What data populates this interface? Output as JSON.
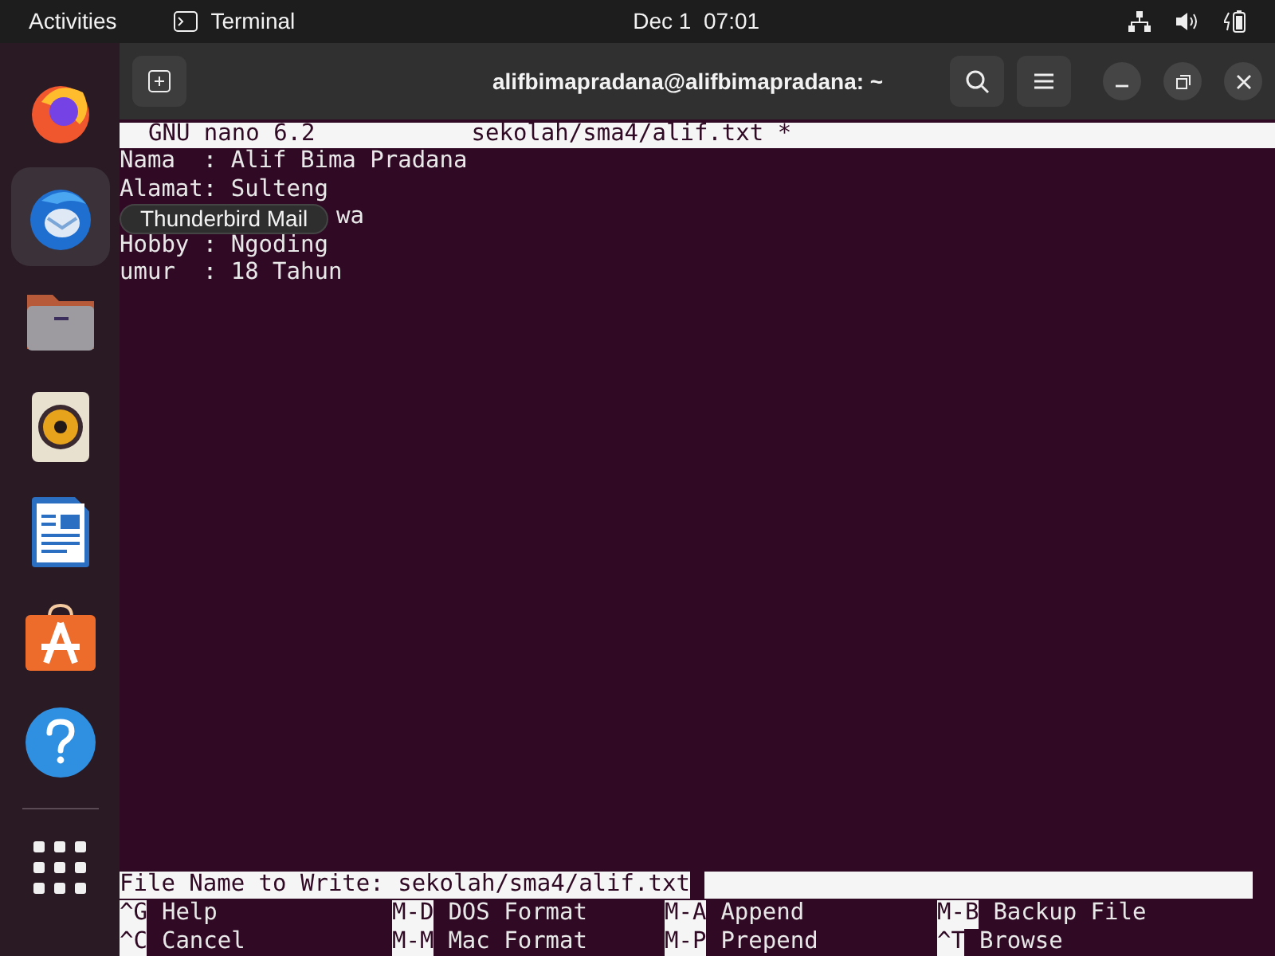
{
  "top_bar": {
    "activities": "Activities",
    "app": "Terminal",
    "clock": "Dec 1  07:01"
  },
  "dock": {
    "items": [
      {
        "kind": "firefox",
        "selected": false
      },
      {
        "kind": "thunderbird",
        "selected": true
      },
      {
        "kind": "files",
        "selected": false
      },
      {
        "kind": "rhythmbox",
        "selected": false
      },
      {
        "kind": "writer",
        "selected": false
      },
      {
        "kind": "store",
        "selected": false
      },
      {
        "kind": "help",
        "selected": false
      }
    ],
    "tooltip": "Thunderbird Mail"
  },
  "window": {
    "title": "alifbimapradana@alifbimapradana: ~"
  },
  "nano": {
    "version": "GNU nano 6.2",
    "file": "sekolah/sma4/alif.txt *",
    "lines": [
      {
        "kind": "full",
        "text": "Nama  : Alif Bima Pradana"
      },
      {
        "kind": "full",
        "text": "Alamat: Sulteng"
      },
      {
        "kind": "covered",
        "text": "wa"
      },
      {
        "kind": "full",
        "text": "Hobby : Ngoding"
      },
      {
        "kind": "full",
        "text": "umur  : 18 Tahun"
      }
    ],
    "prompt": "File Name to Write: sekolah/sma4/alif.txt",
    "shortcuts": [
      [
        {
          "key": "^G",
          "label": "Help"
        },
        {
          "key": "M-D",
          "label": "DOS Format"
        },
        {
          "key": "M-A",
          "label": "Append"
        },
        {
          "key": "M-B",
          "label": "Backup File"
        }
      ],
      [
        {
          "key": "^C",
          "label": "Cancel"
        },
        {
          "key": "M-M",
          "label": "Mac Format"
        },
        {
          "key": "M-P",
          "label": "Prepend"
        },
        {
          "key": "^T",
          "label": "Browse"
        }
      ]
    ]
  }
}
